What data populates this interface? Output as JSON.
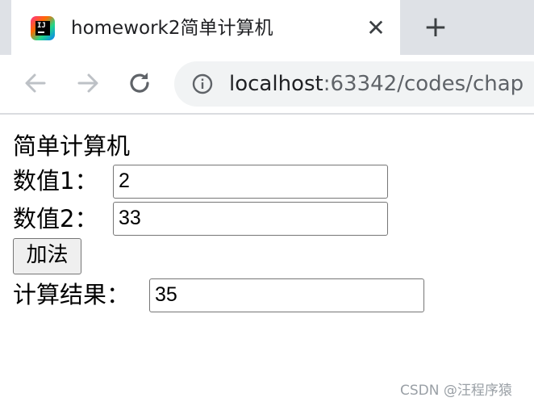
{
  "browser": {
    "tab": {
      "title": "homework2简单计算机",
      "favicon": "jetbrains-icon"
    },
    "close_glyph": "✕",
    "new_tab_glyph": "+",
    "url": {
      "host": "localhost",
      "rest": ":63342/codes/chap"
    }
  },
  "page": {
    "heading": "简单计算机",
    "value1": {
      "label": "数值1：",
      "value": "2"
    },
    "value2": {
      "label": "数值2：",
      "value": "33"
    },
    "add_button": "加法",
    "result": {
      "label": "计算结果：",
      "value": "35"
    }
  },
  "watermark": "CSDN @汪程序猿"
}
